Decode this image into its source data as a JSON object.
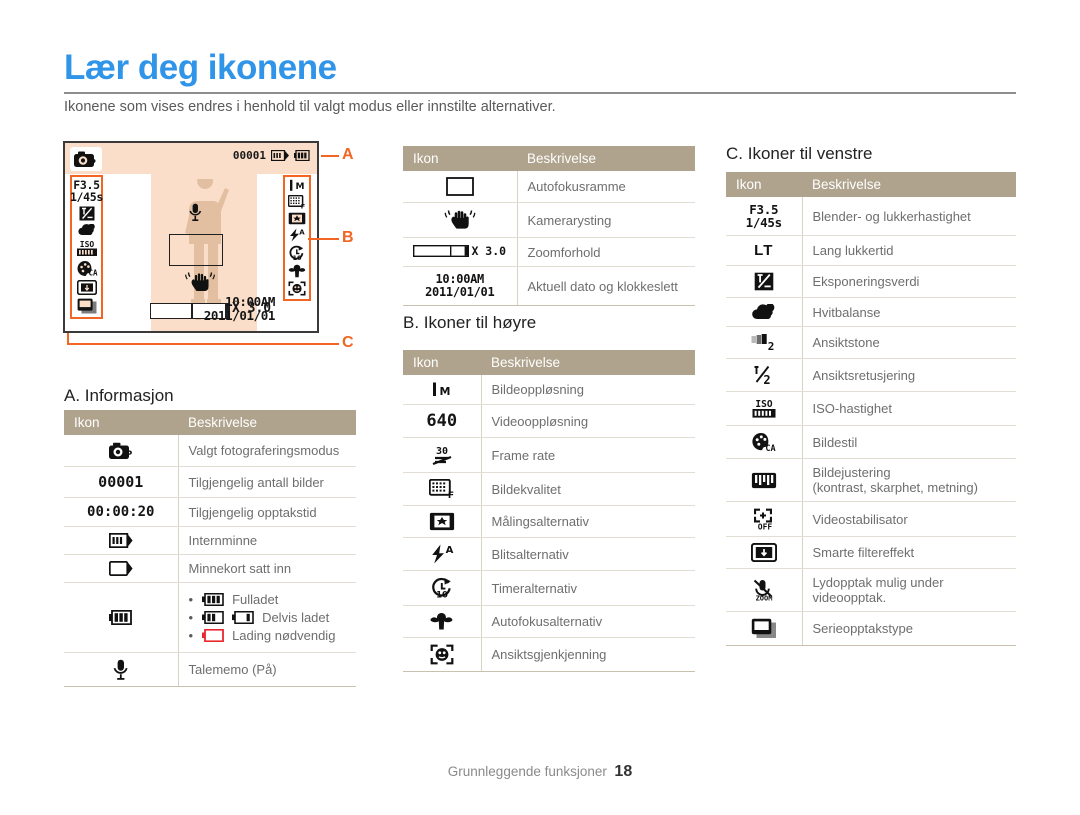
{
  "page": {
    "title": "Lær deg ikonene",
    "intro": "Ikonene som vises endres i henhold til valgt modus eller innstilte alternativer.",
    "footer_text": "Grunnleggende funksjoner",
    "footer_page": "18",
    "colors": {
      "title": "#3094e8",
      "callout": "#f26522",
      "table_header_bg": "#b0a38d",
      "lcd_bg": "#fadeca",
      "body_text": "#6e6e6e"
    }
  },
  "lcd": {
    "shot_counter": "00001",
    "zoom_value": "X 3.0",
    "time": "10:00AM",
    "date": "2011/01/01",
    "left_column": [
      "aperture-shutter",
      "exposure-value",
      "white-balance",
      "iso-speed",
      "photo-style",
      "smart-filter",
      "burst-type"
    ],
    "aperture": "F3.5",
    "shutter": "1/45s",
    "right_column": [
      "photo-resolution",
      "photo-quality",
      "metering",
      "flash",
      "timer",
      "macro-af",
      "face-detection"
    ],
    "resolution_label": "M",
    "callouts": [
      "A",
      "B",
      "C"
    ]
  },
  "sections": {
    "a": {
      "heading": "A. Informasjon"
    },
    "b": {
      "heading": "B. Ikoner til høyre"
    },
    "c": {
      "heading": "C. Ikoner til venstre"
    }
  },
  "table_headers": {
    "icon": "Ikon",
    "description": "Beskrivelse"
  },
  "table_middle_top": {
    "rows": [
      {
        "icon": "af-frame-icon",
        "desc": "Autofokusramme"
      },
      {
        "icon": "camera-shake-icon",
        "desc": "Kamerarysting"
      },
      {
        "icon": "zoom-bar-icon",
        "icon_text": "X 3.0",
        "desc": "Zoomforhold"
      },
      {
        "icon": "date-time-icon",
        "icon_text_1": "10:00AM",
        "icon_text_2": "2011/01/01",
        "desc": "Aktuell dato og klokkeslett"
      }
    ]
  },
  "table_a": {
    "rows": [
      {
        "icon": "shooting-mode-icon",
        "desc": "Valgt fotograferingsmodus"
      },
      {
        "icon": "shots-remaining-icon",
        "icon_text": "00001",
        "desc": "Tilgjengelig antall bilder"
      },
      {
        "icon": "recording-time-icon",
        "icon_text": "00:00:20",
        "desc": "Tilgjengelig opptakstid"
      },
      {
        "icon": "internal-memory-icon",
        "desc": "Internminne"
      },
      {
        "icon": "memory-card-icon",
        "desc": "Minnekort satt inn"
      },
      {
        "icon": "battery-icon",
        "desc_list": [
          "Fulladet",
          "Delvis ladet",
          "Lading nødvendig"
        ]
      },
      {
        "icon": "voice-memo-icon",
        "desc": "Talememo (På)"
      }
    ]
  },
  "table_b": {
    "rows": [
      {
        "icon": "photo-resolution-icon",
        "icon_text": "M",
        "desc": "Bildeoppløsning"
      },
      {
        "icon": "video-resolution-icon",
        "icon_text": "640",
        "desc": "Videooppløsning"
      },
      {
        "icon": "frame-rate-icon",
        "icon_text": "30",
        "desc": "Frame rate"
      },
      {
        "icon": "photo-quality-icon",
        "desc": "Bildekvalitet"
      },
      {
        "icon": "metering-icon",
        "desc": "Målingsalternativ"
      },
      {
        "icon": "flash-icon",
        "desc": "Blitsalternativ"
      },
      {
        "icon": "timer-icon",
        "desc": "Timeralternativ"
      },
      {
        "icon": "macro-af-icon",
        "desc": "Autofokusalternativ"
      },
      {
        "icon": "face-detection-icon",
        "desc": "Ansiktsgjenkjenning"
      }
    ]
  },
  "table_c": {
    "rows": [
      {
        "icon": "aperture-shutter-icon",
        "icon_text_1": "F3.5",
        "icon_text_2": "1/45s",
        "desc": "Blender- og lukkerhastighet"
      },
      {
        "icon": "long-time-icon",
        "icon_text": "LT",
        "desc": "Lang lukkertid"
      },
      {
        "icon": "exposure-value-icon",
        "desc": "Eksponeringsverdi"
      },
      {
        "icon": "white-balance-icon",
        "desc": "Hvitbalanse"
      },
      {
        "icon": "face-tone-icon",
        "desc": "Ansiktstone"
      },
      {
        "icon": "face-retouch-icon",
        "desc": "Ansiktsretusjering"
      },
      {
        "icon": "iso-speed-icon",
        "desc": "ISO-hastighet"
      },
      {
        "icon": "photo-style-icon",
        "desc": "Bildestil"
      },
      {
        "icon": "image-adjust-icon",
        "desc": "Bildejustering",
        "desc2": "(kontrast, skarphet, metning)"
      },
      {
        "icon": "video-stabilizer-icon",
        "desc": "Videostabilisator"
      },
      {
        "icon": "smart-filter-icon",
        "desc": "Smarte filtereffekt"
      },
      {
        "icon": "audio-zoom-icon",
        "desc": "Lydopptak mulig under videoopptak."
      },
      {
        "icon": "burst-type-icon",
        "desc": "Serieopptakstype"
      }
    ]
  }
}
